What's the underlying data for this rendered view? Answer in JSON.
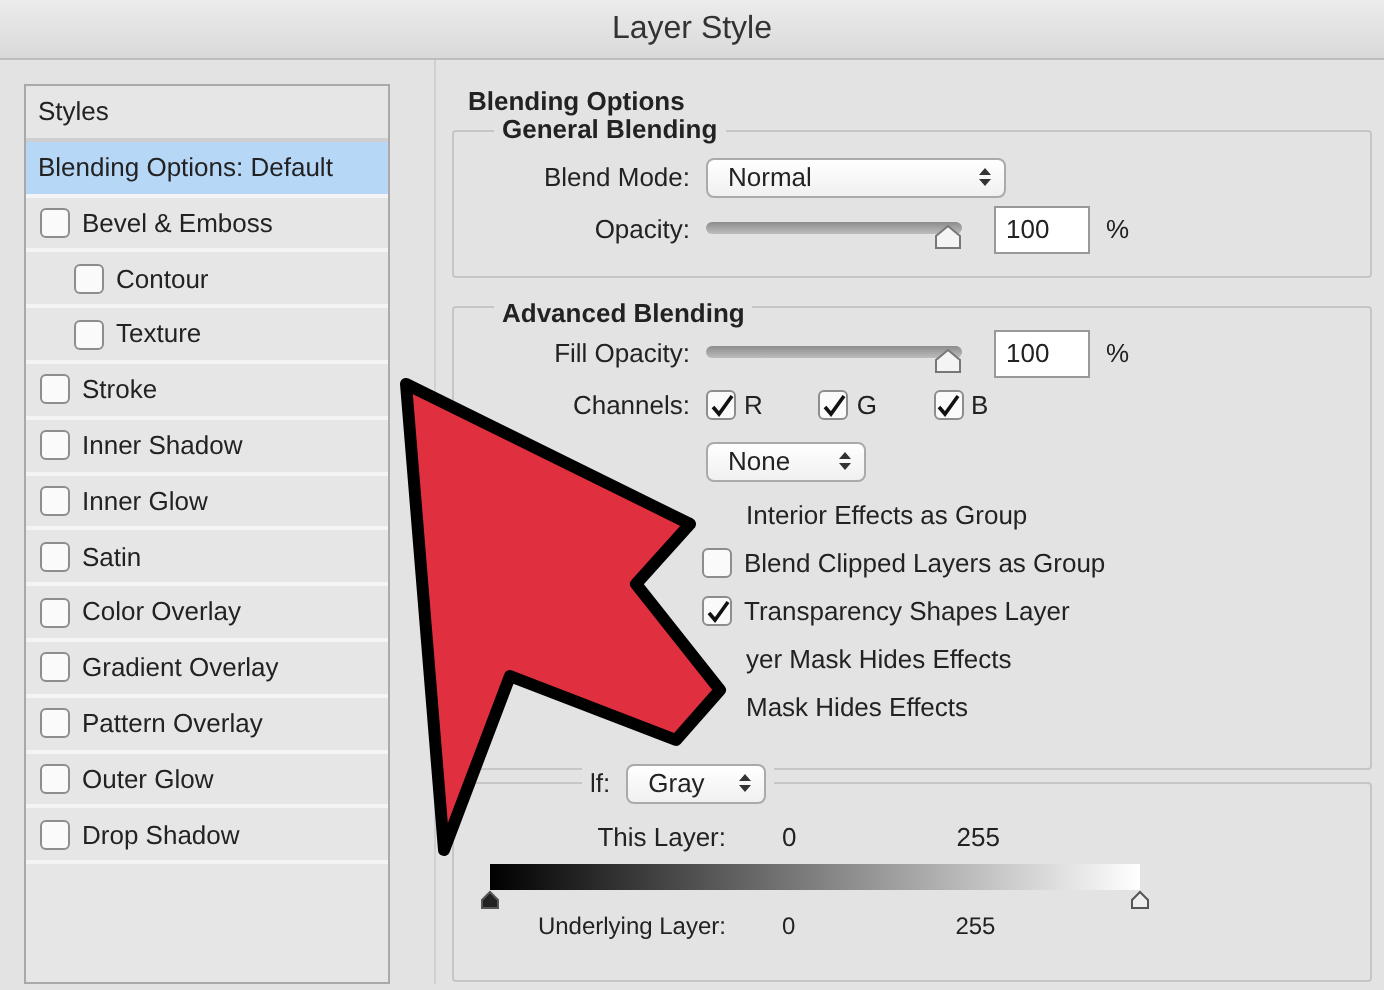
{
  "window": {
    "title": "Layer Style"
  },
  "styles_panel": {
    "header": "Styles",
    "items": [
      {
        "label": "Blending Options: Default",
        "kind": "plain",
        "selected": true
      },
      {
        "label": "Bevel & Emboss",
        "kind": "checkbox",
        "checked": false,
        "selected": false,
        "children": [
          {
            "label": "Contour",
            "kind": "checkbox",
            "checked": false,
            "selected": false
          },
          {
            "label": "Texture",
            "kind": "checkbox",
            "checked": false,
            "selected": false
          }
        ]
      },
      {
        "label": "Stroke",
        "kind": "checkbox",
        "checked": false,
        "selected": false
      },
      {
        "label": "Inner Shadow",
        "kind": "checkbox",
        "checked": false,
        "selected": false
      },
      {
        "label": "Inner Glow",
        "kind": "checkbox",
        "checked": false,
        "selected": false
      },
      {
        "label": "Satin",
        "kind": "checkbox",
        "checked": false,
        "selected": false
      },
      {
        "label": "Color Overlay",
        "kind": "checkbox",
        "checked": false,
        "selected": false
      },
      {
        "label": "Gradient Overlay",
        "kind": "checkbox",
        "checked": false,
        "selected": false
      },
      {
        "label": "Pattern Overlay",
        "kind": "checkbox",
        "checked": false,
        "selected": false
      },
      {
        "label": "Outer Glow",
        "kind": "checkbox",
        "checked": false,
        "selected": false
      },
      {
        "label": "Drop Shadow",
        "kind": "checkbox",
        "checked": false,
        "selected": false
      }
    ]
  },
  "blending_options": {
    "title": "Blending Options",
    "general": {
      "title": "General Blending",
      "blend_mode": {
        "label": "Blend Mode:",
        "value": "Normal"
      },
      "opacity": {
        "label": "Opacity:",
        "level": 1,
        "value": "100",
        "unit": "%"
      }
    },
    "advanced": {
      "title": "Advanced Blending",
      "fill_opacity": {
        "label": "Fill Opacity:",
        "level": 1,
        "value": "100",
        "unit": "%"
      },
      "channels": {
        "label": "Channels:",
        "items": [
          {
            "label": "R",
            "checked": true
          },
          {
            "label": "G",
            "checked": true
          },
          {
            "label": "B",
            "checked": true
          }
        ]
      },
      "knockout": {
        "value": "None"
      },
      "options": [
        {
          "label": "Interior Effects as Group"
        },
        {
          "label": "Blend Clipped Layers as Group",
          "checked": false
        },
        {
          "label": "Transparency Shapes Layer",
          "checked": true
        },
        {
          "label": "yer Mask Hides Effects"
        },
        {
          "label": "Mask Hides Effects"
        }
      ]
    },
    "blend_if": {
      "label": "lf:",
      "value": "Gray",
      "this_layer": {
        "label": "This Layer:",
        "low": "0",
        "high": "255"
      },
      "underlying_layer": {
        "label": "Underlying Layer:",
        "low": "0",
        "high": "255"
      }
    }
  }
}
